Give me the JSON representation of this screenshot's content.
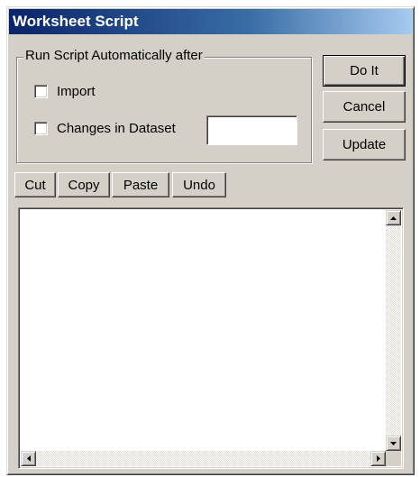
{
  "window": {
    "title": "Worksheet Script"
  },
  "auto_run": {
    "group_label": "Run Script Automatically after",
    "options": [
      {
        "label": "Import",
        "checked": false
      },
      {
        "label": "Changes in Dataset",
        "checked": false
      }
    ],
    "dataset_field_value": ""
  },
  "actions": {
    "do_it": "Do It",
    "cancel": "Cancel",
    "update": "Update"
  },
  "edit_toolbar": {
    "cut": "Cut",
    "copy": "Copy",
    "paste": "Paste",
    "undo": "Undo"
  },
  "script_editor": {
    "content": ""
  },
  "icons": {
    "scroll_up": "triangle-up-icon",
    "scroll_down": "triangle-down-icon",
    "scroll_left": "triangle-left-icon",
    "scroll_right": "triangle-right-icon"
  },
  "colors": {
    "face": "#d4d0c8",
    "title_active": "#0a246a",
    "title_gradient_end": "#a6caf0"
  }
}
